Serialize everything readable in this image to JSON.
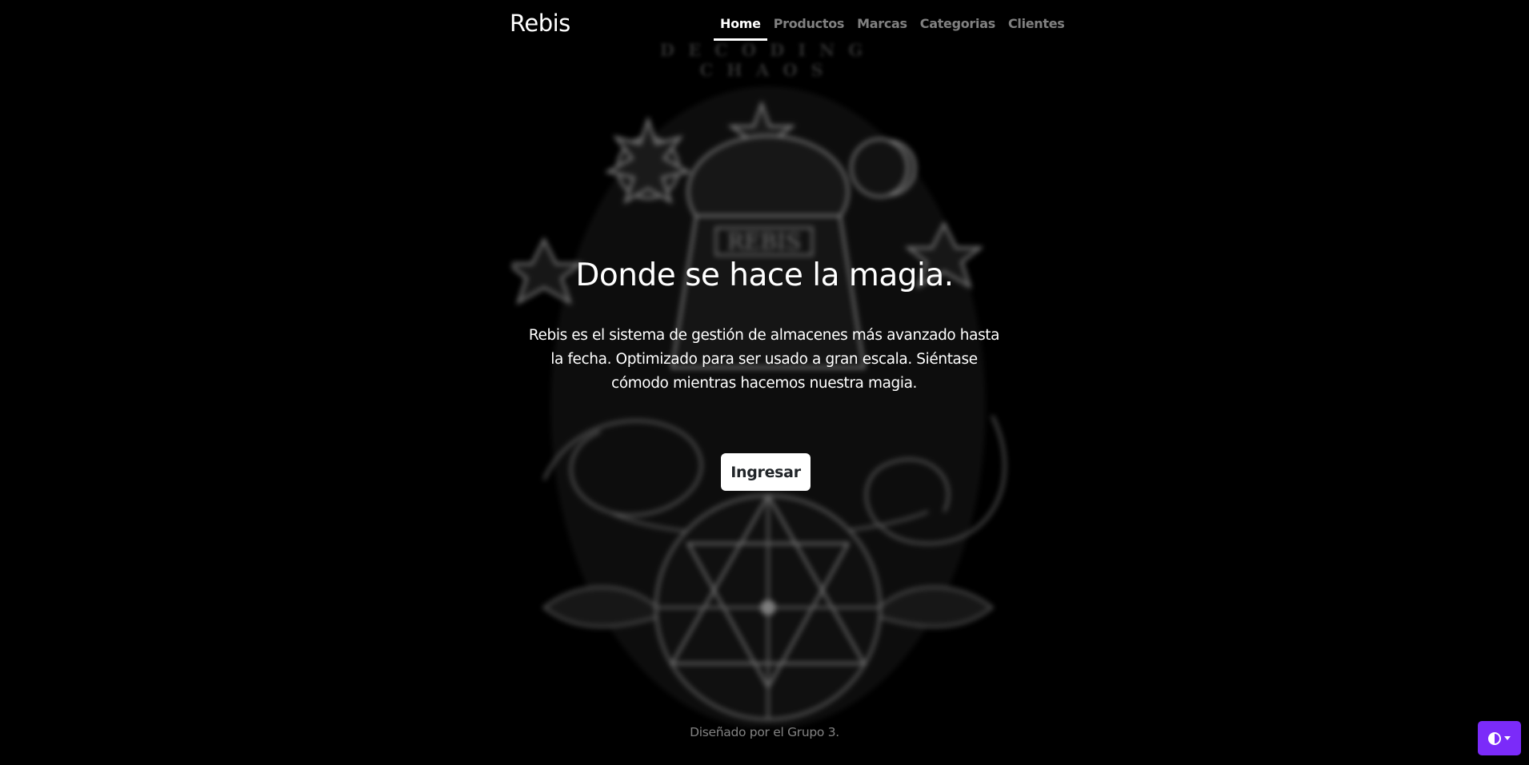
{
  "brand": {
    "name": "Rebis"
  },
  "nav": {
    "items": [
      {
        "label": "Home",
        "active": true
      },
      {
        "label": "Productos",
        "active": false
      },
      {
        "label": "Marcas",
        "active": false
      },
      {
        "label": "Categorias",
        "active": false
      },
      {
        "label": "Clientes",
        "active": false
      }
    ]
  },
  "background": {
    "motto": "DECODING CHAOS",
    "emblem_label": "REBIS",
    "emblem_icon": "alchemical-rebis-emblem"
  },
  "hero": {
    "title": "Donde se hace la magia.",
    "text": "Rebis es el sistema de gestión de almacenes más avanzado hasta la fecha. Optimizado para ser usado a gran escala. Siéntase cómodo mientras hacemos nuestra magia.",
    "cta_label": "Ingresar"
  },
  "footer": {
    "text": "Diseñado por el Grupo 3."
  },
  "theme_toggle": {
    "icon": "circle-half-icon",
    "accent": "#7b2bf9"
  }
}
